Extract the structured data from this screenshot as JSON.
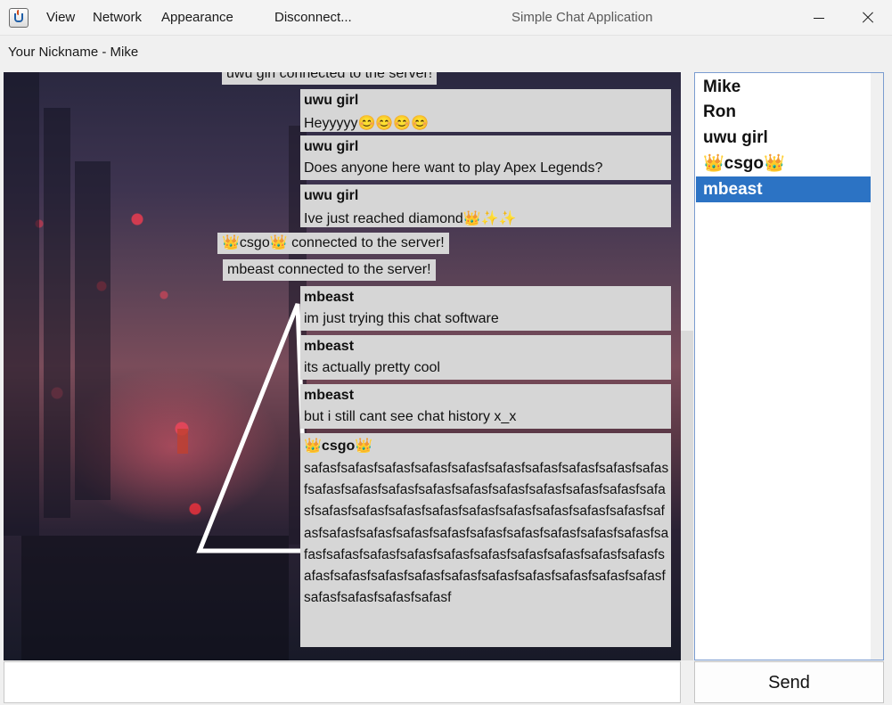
{
  "window": {
    "title": "Simple Chat Application",
    "menu": [
      "View",
      "Network",
      "Appearance",
      "Disconnect..."
    ]
  },
  "nickname_label": "Your Nickname - Mike",
  "chat": {
    "system_top_partial": "uwu girl connected to the server!",
    "messages": [
      {
        "sender": "uwu girl",
        "text": "Heyyyyy😊😊😊😊"
      },
      {
        "sender": "uwu girl",
        "text": "Does anyone here want to play Apex Legends?"
      },
      {
        "sender": "uwu girl",
        "text": "Ive just reached diamond👑✨✨"
      },
      {
        "sender": "mbeast",
        "text": "im just trying this chat software"
      },
      {
        "sender": "mbeast",
        "text": "its actually pretty cool"
      },
      {
        "sender": "mbeast",
        "text": "but i still cant see chat history x_x"
      },
      {
        "sender": "👑csgo👑",
        "text": "safasfsafasfsafasfsafasfsafasfsafasfsafasfsafasfsafasfsafasfsafasfsafasfsafasfsafasfsafasfsafasfsafasfsafasfsafasfsafasfsafasfsafasfsafasfsafasfsafasfsafasfsafasfsafasfsafasfsafasfsafasfsafasfsafasfsafasfsafasfsafasfsafasfsafasfsafasfsafasfsafasfsafasfsafasfsafasfsafasfsafasfsafasfsafasfsafasfsafasfsafasfsafasfsafasfsafasfsafasfsafasfsafasfsafasfsafasfsafasfsafasfsafasfsafasf"
      }
    ],
    "system": [
      "👑csgo👑 connected to the server!",
      "mbeast connected to the server!"
    ]
  },
  "users": [
    "Mike",
    "Ron",
    "uwu girl",
    "👑csgo👑",
    "mbeast"
  ],
  "selected_user": "mbeast",
  "input": {
    "value": "",
    "placeholder": ""
  },
  "send_label": "Send",
  "colors": {
    "selected": "#2c73c4",
    "bubble": "#d6d6d6",
    "border": "#7a9cd0"
  }
}
